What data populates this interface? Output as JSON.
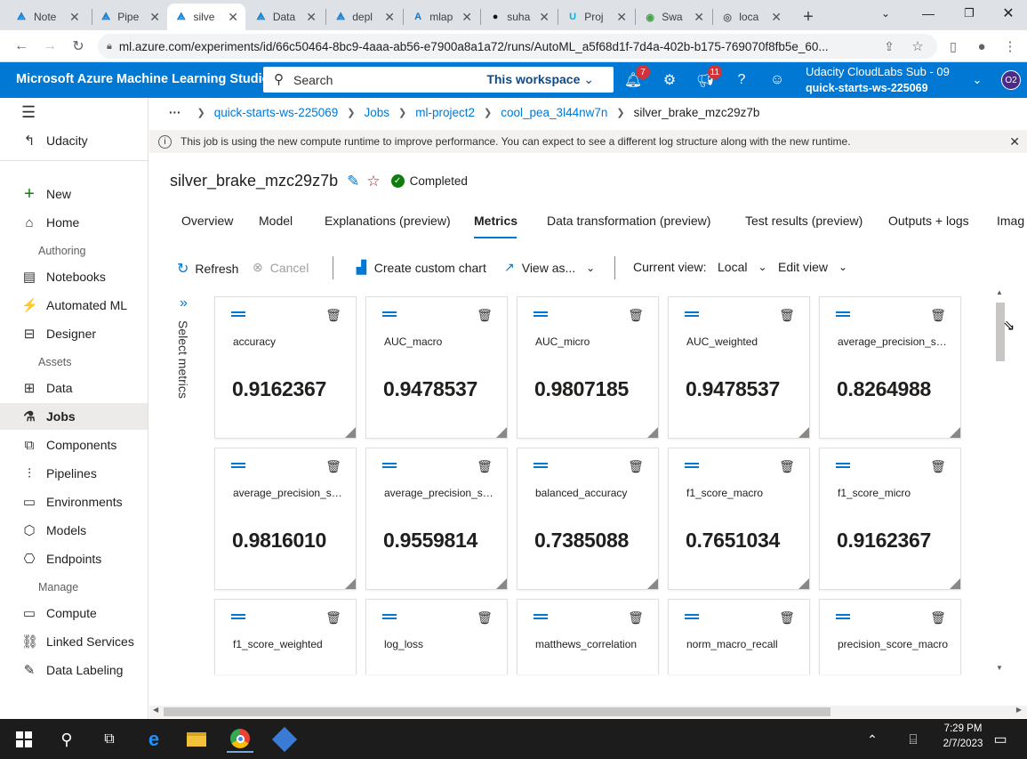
{
  "browser": {
    "tabs": [
      {
        "icon": "azure-ml-icon",
        "title": "Note",
        "active": false
      },
      {
        "icon": "azure-ml-icon",
        "title": "Pipe",
        "active": false
      },
      {
        "icon": "azure-ml-icon",
        "title": "silve",
        "active": true
      },
      {
        "icon": "azure-ml-icon",
        "title": "Data",
        "active": false
      },
      {
        "icon": "azure-ml-icon",
        "title": "depl",
        "active": false
      },
      {
        "icon": "azure-icon",
        "title": "mlap",
        "active": false
      },
      {
        "icon": "github-icon",
        "title": "suha",
        "active": false
      },
      {
        "icon": "udacity-icon",
        "title": "Proj",
        "active": false
      },
      {
        "icon": "swagger-icon",
        "title": "Swa",
        "active": false
      },
      {
        "icon": "globe-icon",
        "title": "loca",
        "active": false
      }
    ],
    "url": "ml.azure.com/experiments/id/66c50464-8bc9-4aaa-ab56-e7900a8a1a72/runs/AutoML_a5f68d1f-7d4a-402b-b175-769070f8fb5e_60..."
  },
  "header": {
    "brand": "Microsoft Azure Machine Learning Studio",
    "search_label": "Search",
    "search_scope": "This workspace",
    "notifications_count": "7",
    "announcements_count": "11",
    "account_name": "Udacity CloudLabs Sub - 09",
    "account_workspace": "quick-starts-ws-225069",
    "avatar_initials": "O2"
  },
  "sidebar": {
    "workspace": "Udacity",
    "new_label": "New",
    "home_label": "Home",
    "authoring_label": "Authoring",
    "authoring": [
      "Notebooks",
      "Automated ML",
      "Designer"
    ],
    "assets_label": "Assets",
    "assets": [
      "Data",
      "Jobs",
      "Components",
      "Pipelines",
      "Environments",
      "Models",
      "Endpoints"
    ],
    "manage_label": "Manage",
    "manage": [
      "Compute",
      "Linked Services",
      "Data Labeling"
    ]
  },
  "breadcrumb": {
    "more": "···",
    "items": [
      "quick-starts-ws-225069",
      "Jobs",
      "ml-project2",
      "cool_pea_3l44nw7n",
      "silver_brake_mzc29z7b"
    ]
  },
  "info_message": "This job is using the new compute runtime to improve performance. You can expect to see a different log structure along with the new runtime.",
  "job": {
    "name": "silver_brake_mzc29z7b",
    "status": "Completed"
  },
  "tabs": [
    "Overview",
    "Model",
    "Explanations (preview)",
    "Metrics",
    "Data transformation (preview)",
    "Test results (preview)",
    "Outputs + logs",
    "Imag"
  ],
  "toolbar": {
    "refresh": "Refresh",
    "cancel": "Cancel",
    "create_chart": "Create custom chart",
    "view_as": "View as...",
    "current_view_label": "Current view:",
    "current_view": "Local",
    "edit_view": "Edit view"
  },
  "select_metrics_label": "Select metrics",
  "metrics": [
    {
      "name": "accuracy",
      "value": "0.9162367"
    },
    {
      "name": "AUC_macro",
      "value": "0.9478537"
    },
    {
      "name": "AUC_micro",
      "value": "0.9807185"
    },
    {
      "name": "AUC_weighted",
      "value": "0.9478537"
    },
    {
      "name": "average_precision_sco...",
      "value": "0.8264988"
    },
    {
      "name": "average_precision_sco...",
      "value": "0.9816010"
    },
    {
      "name": "average_precision_sco...",
      "value": "0.9559814"
    },
    {
      "name": "balanced_accuracy",
      "value": "0.7385088"
    },
    {
      "name": "f1_score_macro",
      "value": "0.7651034"
    },
    {
      "name": "f1_score_micro",
      "value": "0.9162367"
    },
    {
      "name": "f1_score_weighted",
      "value": ""
    },
    {
      "name": "log_loss",
      "value": ""
    },
    {
      "name": "matthews_correlation",
      "value": ""
    },
    {
      "name": "norm_macro_recall",
      "value": ""
    },
    {
      "name": "precision_score_macro",
      "value": ""
    }
  ],
  "taskbar": {
    "time": "7:29 PM",
    "date": "2/7/2023"
  }
}
